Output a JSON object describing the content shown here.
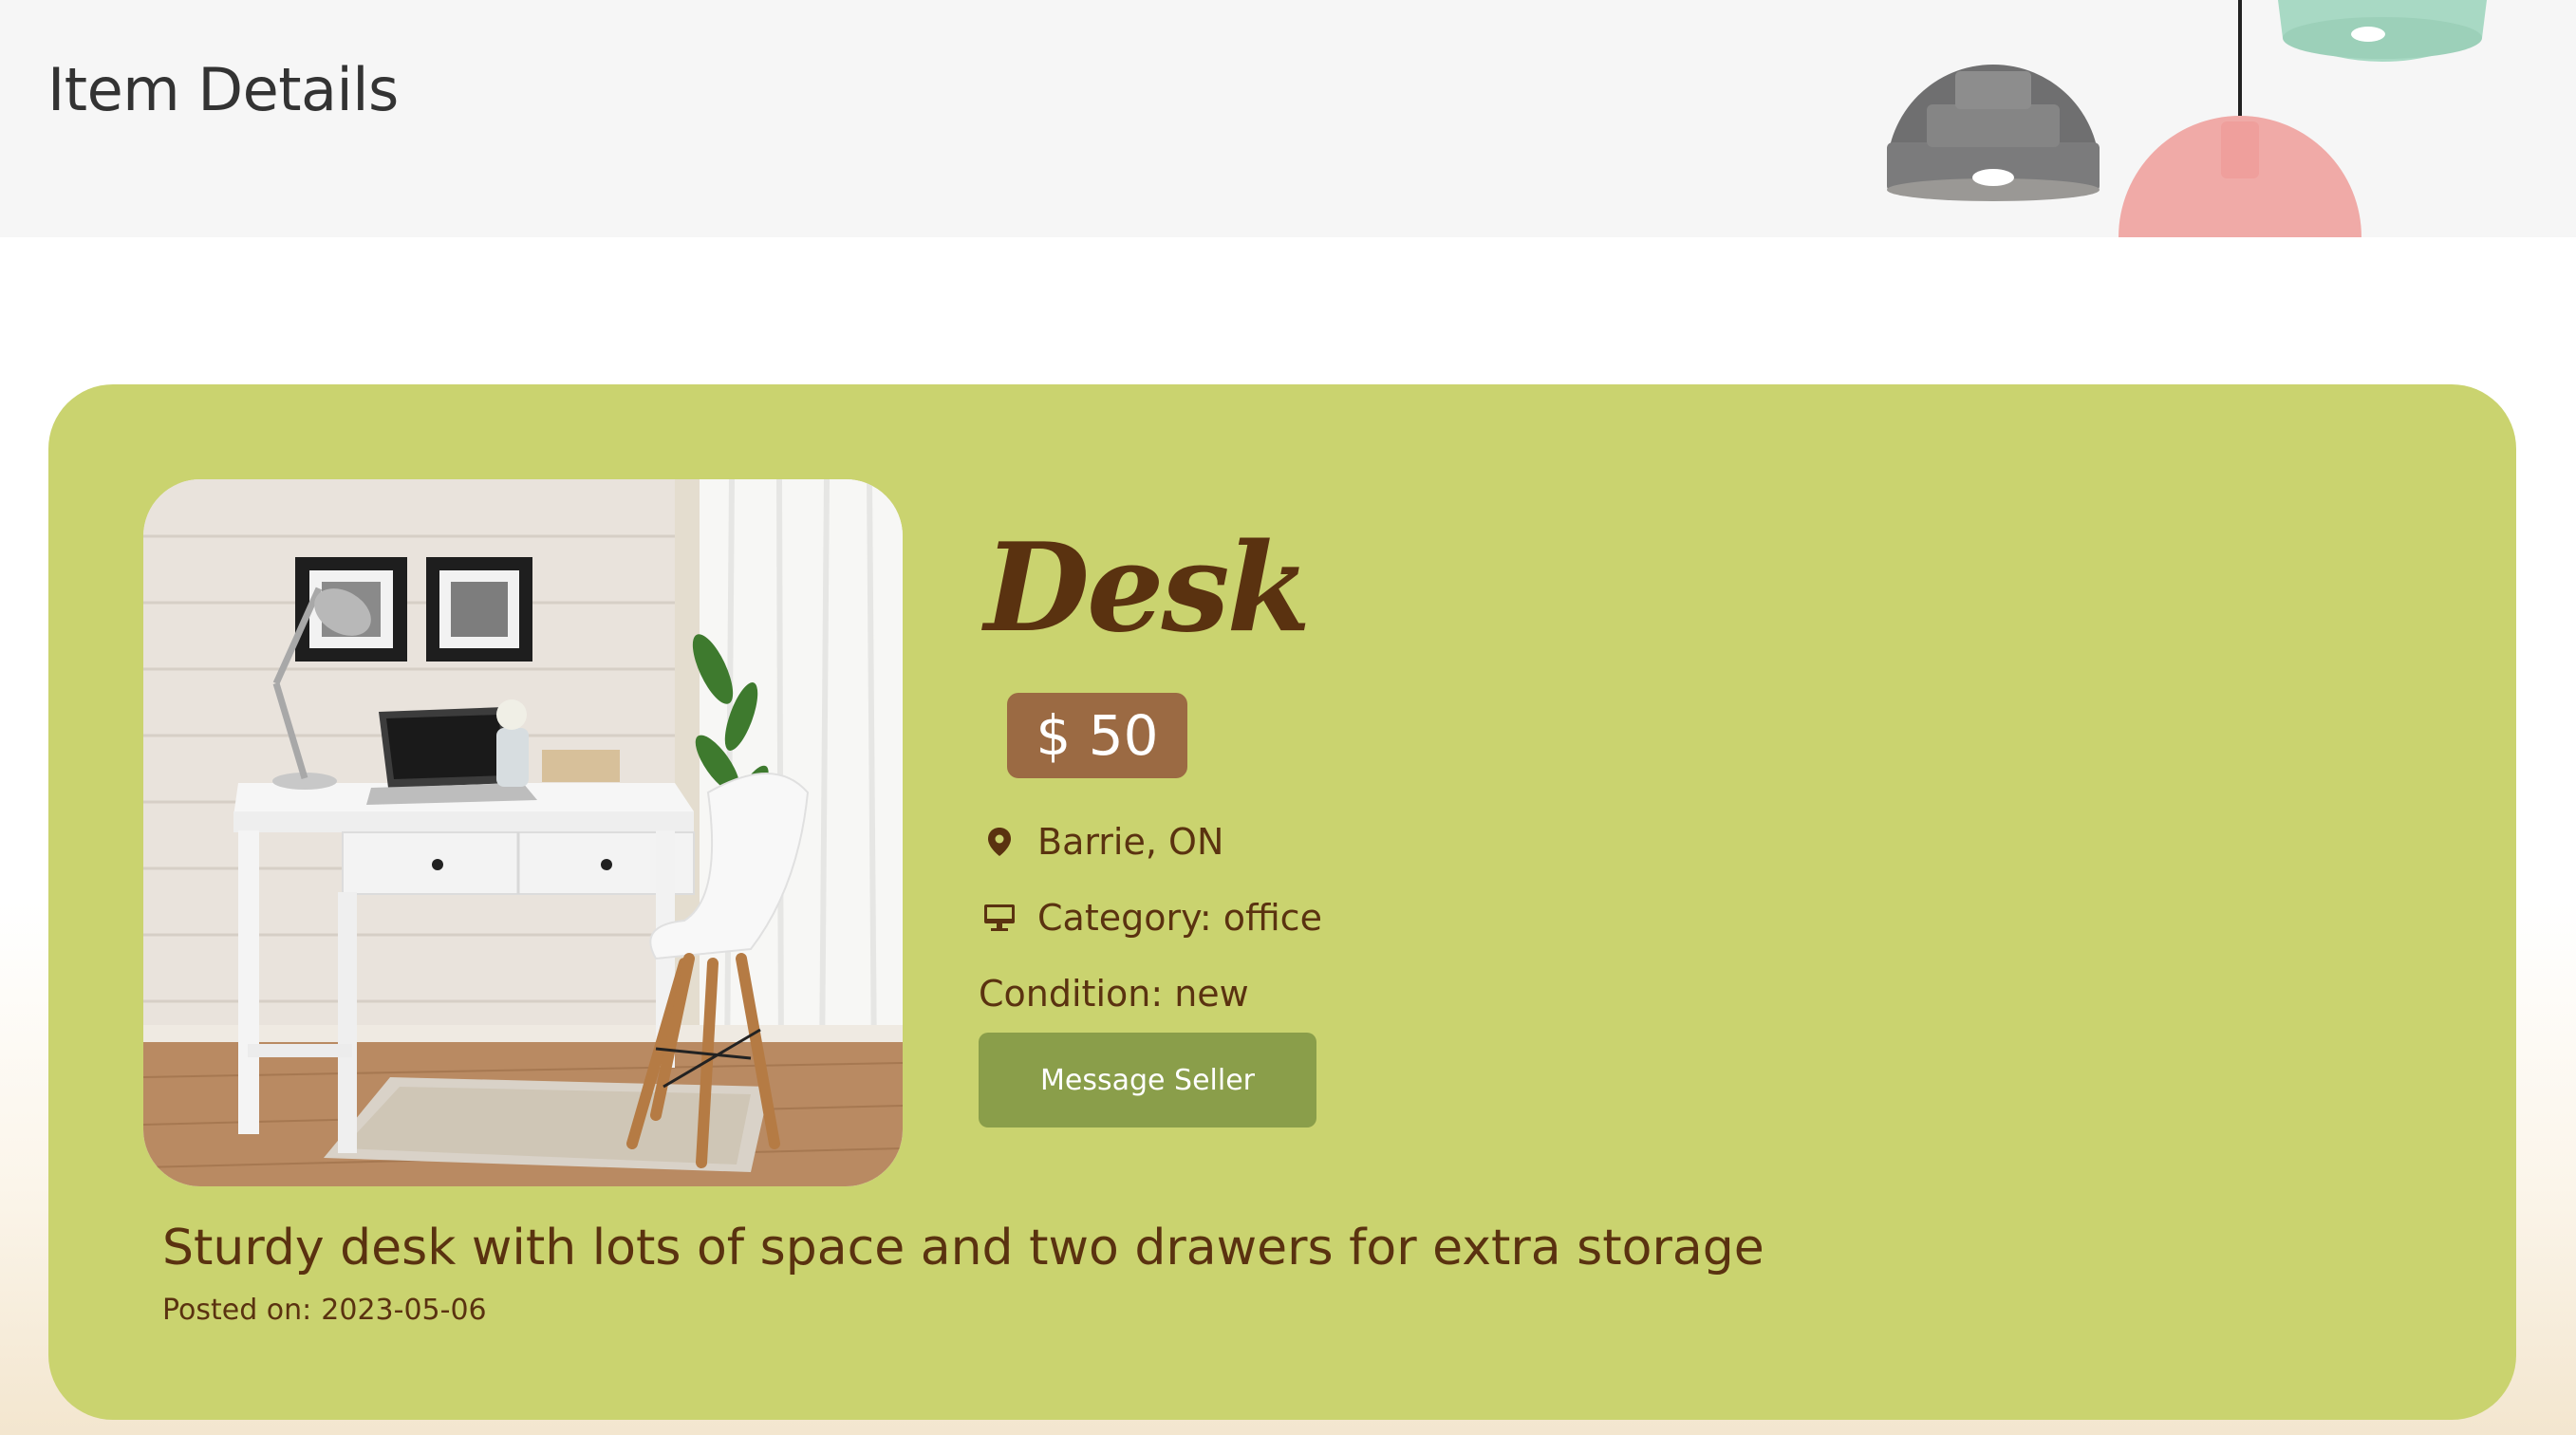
{
  "header": {
    "title": "Item Details"
  },
  "item": {
    "title": "Desk",
    "price": "$ 50",
    "location": "Barrie, ON",
    "category_label": "Category: office",
    "condition_label": "Condition: new",
    "message_button": "Message Seller",
    "description": "Sturdy desk with lots of space and two drawers for extra storage",
    "posted_label": "Posted on:",
    "posted_date": "2023-05-06"
  },
  "icons": {
    "location": "map-pin-icon",
    "category": "monitor-icon"
  },
  "colors": {
    "card": "#cad36f",
    "title": "#5a3210",
    "price_badge": "#9b6a43",
    "button": "#8a9e4a",
    "header_bg": "#f6f6f6"
  }
}
